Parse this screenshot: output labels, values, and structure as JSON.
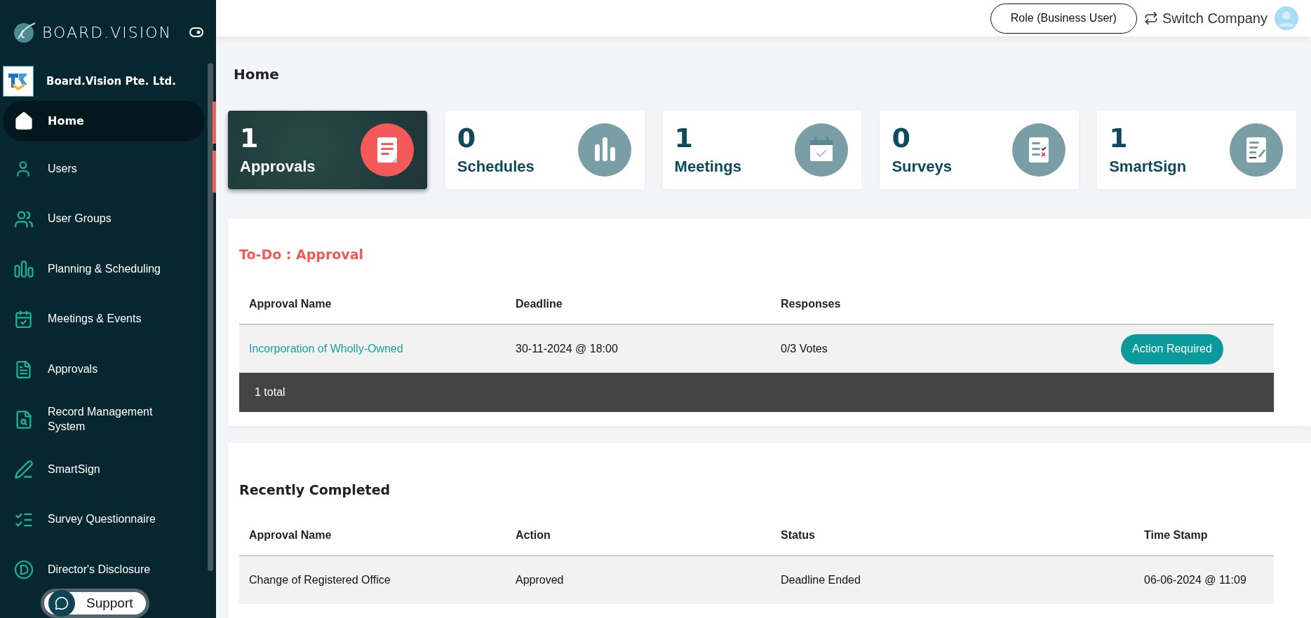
{
  "sidebar": {
    "brand": "BOARD.VISION",
    "company": "Board.Vision Pte. Ltd.",
    "items": [
      {
        "label": "Home",
        "selected": true
      },
      {
        "label": "Users",
        "selected": false
      },
      {
        "label": "User Groups",
        "selected": false
      },
      {
        "label": "Planning & Scheduling",
        "selected": false
      },
      {
        "label": "Meetings & Events",
        "selected": false
      },
      {
        "label": "Approvals",
        "selected": false
      },
      {
        "label": "Record Management System",
        "selected": false
      },
      {
        "label": "SmartSign",
        "selected": false
      },
      {
        "label": "Survey Questionnaire",
        "selected": false
      },
      {
        "label": "Director's Disclosure",
        "selected": false
      }
    ],
    "support": "Support"
  },
  "header": {
    "role": "Role (Business User)",
    "switch": "Switch Company"
  },
  "page_title": "Home",
  "cards": [
    {
      "count": "1",
      "label": "Approvals",
      "selected": true
    },
    {
      "count": "0",
      "label": "Schedules",
      "selected": false
    },
    {
      "count": "1",
      "label": "Meetings",
      "selected": false
    },
    {
      "count": "0",
      "label": "Surveys",
      "selected": false
    },
    {
      "count": "1",
      "label": "SmartSign",
      "selected": false
    }
  ],
  "todo": {
    "title": "To-Do : Approval",
    "columns": [
      "Approval Name",
      "Deadline",
      "Responses"
    ],
    "rows": [
      {
        "name": "Incorporation of Wholly-Owned",
        "deadline": "30-11-2024 @ 18:00",
        "responses": "0/3 Votes",
        "action": "Action Required"
      }
    ],
    "footer": "1 total"
  },
  "completed": {
    "title": "Recently Completed",
    "columns": [
      "Approval Name",
      "Action",
      "Status",
      "Time Stamp"
    ],
    "rows": [
      {
        "name": "Change of Registered Office",
        "action": "Approved",
        "status": "Deadline Ended",
        "time": "06-06-2024 @ 11:09"
      }
    ]
  }
}
